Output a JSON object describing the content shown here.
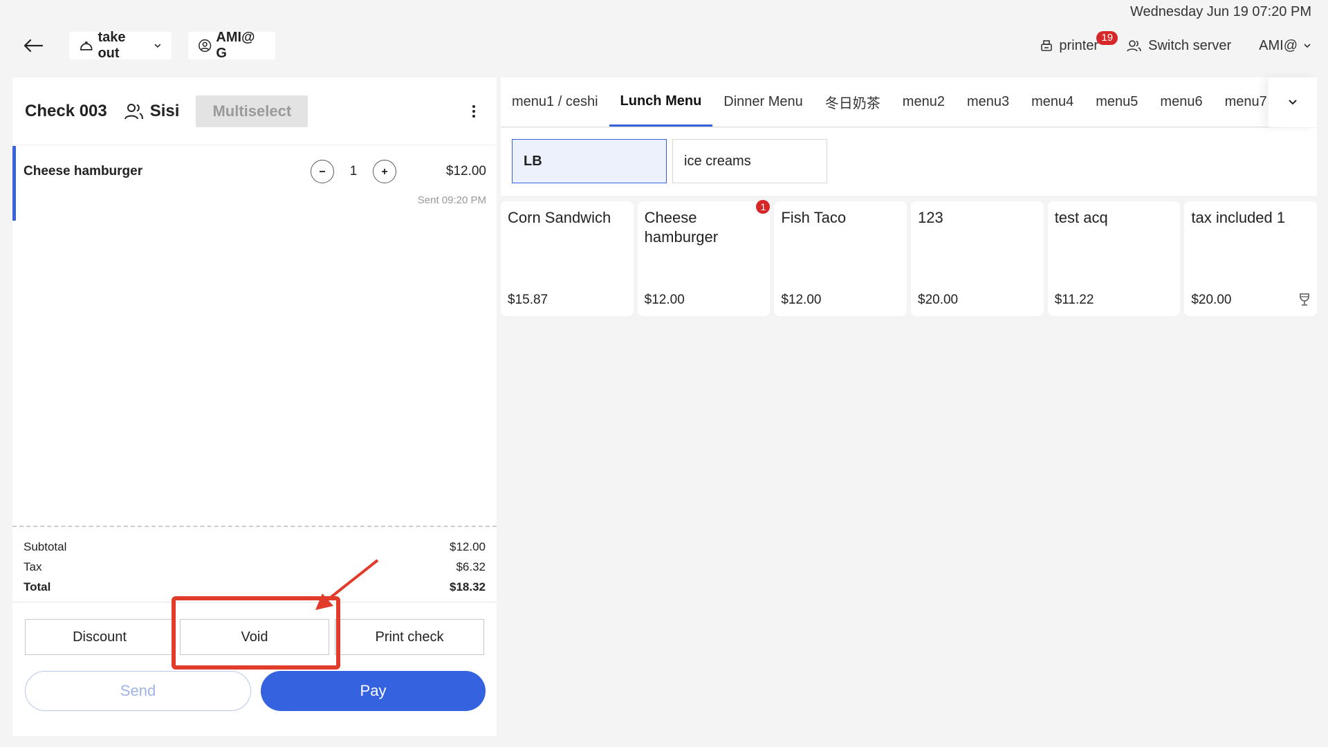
{
  "header": {
    "datetime": "Wednesday Jun 19 07:20 PM",
    "order_type": "take out",
    "user": "AMI@ G",
    "printer_label": "printer",
    "printer_count": "19",
    "switch_server": "Switch server",
    "account": "AMI@"
  },
  "check": {
    "title": "Check 003",
    "guest": "Sisi",
    "multiselect": "Multiselect",
    "items": [
      {
        "name": "Cheese hamburger",
        "qty": "1",
        "price": "$12.00",
        "status": "Sent 09:20 PM"
      }
    ],
    "subtotal_label": "Subtotal",
    "subtotal": "$12.00",
    "tax_label": "Tax",
    "tax": "$6.32",
    "total_label": "Total",
    "total": "$18.32",
    "discount": "Discount",
    "void": "Void",
    "print_check": "Print check",
    "send": "Send",
    "pay": "Pay"
  },
  "menu": {
    "tabs": [
      "menu1 / ceshi",
      "Lunch Menu",
      "Dinner Menu",
      "冬日奶茶",
      "menu2",
      "menu3",
      "menu4",
      "menu5",
      "menu6",
      "menu7"
    ],
    "active_tab": "Lunch Menu",
    "categories": [
      "LB",
      "ice creams"
    ],
    "items": [
      {
        "name": "Corn Sandwich",
        "price": "$15.87"
      },
      {
        "name": "Cheese hamburger",
        "price": "$12.00",
        "badge": "1"
      },
      {
        "name": "Fish Taco",
        "price": "$12.00"
      },
      {
        "name": "123",
        "price": "$20.00"
      },
      {
        "name": "test acq",
        "price": "$11.22"
      },
      {
        "name": "tax included 1",
        "price": "$20.00",
        "icon": "wine-glass-icon"
      }
    ]
  },
  "colors": {
    "accent": "#3563e0",
    "badge": "#d62828",
    "highlight": "#e03b2b"
  }
}
